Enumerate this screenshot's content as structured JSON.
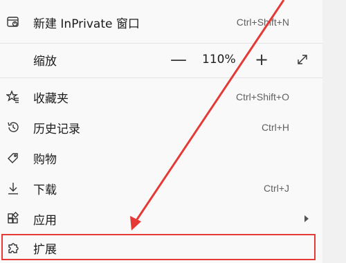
{
  "menu": {
    "items": [
      {
        "label": "新建 InPrivate 窗口",
        "shortcut": "Ctrl+Shift+N",
        "icon": "inprivate-window-icon"
      },
      {
        "label": "缩放",
        "icon": ""
      },
      {
        "label": "收藏夹",
        "shortcut": "Ctrl+Shift+O",
        "icon": "favorites-icon"
      },
      {
        "label": "历史记录",
        "shortcut": "Ctrl+H",
        "icon": "history-icon"
      },
      {
        "label": "购物",
        "shortcut": "",
        "icon": "shopping-tag-icon"
      },
      {
        "label": "下载",
        "shortcut": "Ctrl+J",
        "icon": "download-icon"
      },
      {
        "label": "应用",
        "shortcut": "",
        "icon": "apps-icon"
      },
      {
        "label": "扩展",
        "shortcut": "",
        "icon": "extensions-puzzle-icon"
      }
    ]
  },
  "zoom": {
    "minus": "—",
    "value": "110%",
    "plus": "+",
    "fullscreen_icon": "fullscreen-icon"
  },
  "annotation": {
    "color": "#e53935"
  }
}
